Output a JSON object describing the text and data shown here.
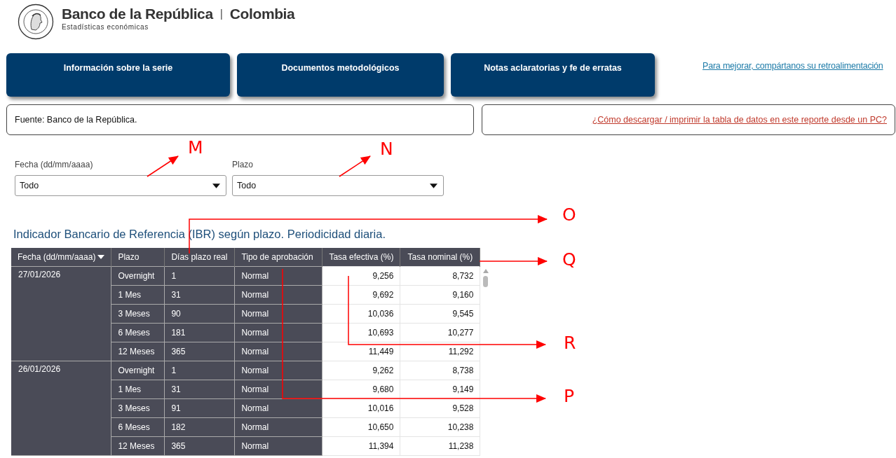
{
  "header": {
    "title": "Banco de la República",
    "separator": "|",
    "country": "Colombia",
    "subtitle": "Estadísticas económicas"
  },
  "nav_buttons": [
    "Información sobre la serie",
    "Documentos metodológicos",
    "Notas aclaratorias y fe de erratas"
  ],
  "feedback_link": "Para mejorar, compártanos su retroalimentación",
  "source": "Fuente: Banco de la República.",
  "help_link": "¿Cómo descargar / imprimir la tabla de datos en este reporte desde un PC?",
  "filters": [
    {
      "label": "Fecha (dd/mm/aaaa)",
      "value": "Todo"
    },
    {
      "label": "Plazo",
      "value": "Todo"
    }
  ],
  "table": {
    "title": "Indicador Bancario de Referencia (IBR) según plazo. Periodicidad diaria.",
    "columns": [
      {
        "label": "Fecha (dd/mm/aaaa)",
        "sorted": true
      },
      {
        "label": "Plazo",
        "sorted": false
      },
      {
        "label": "Días plazo real",
        "sorted": false
      },
      {
        "label": "Tipo de aprobación",
        "sorted": false
      },
      {
        "label": "Tasa efectiva (%)",
        "sorted": false
      },
      {
        "label": "Tasa nominal (%)",
        "sorted": false
      }
    ],
    "groups": [
      {
        "date": "27/01/2026",
        "rows": [
          [
            "Overnight",
            "1",
            "Normal",
            "9,256",
            "8,732"
          ],
          [
            "1 Mes",
            "31",
            "Normal",
            "9,692",
            "9,160"
          ],
          [
            "3 Meses",
            "90",
            "Normal",
            "10,036",
            "9,545"
          ],
          [
            "6 Meses",
            "181",
            "Normal",
            "10,693",
            "10,277"
          ],
          [
            "12 Meses",
            "365",
            "Normal",
            "11,449",
            "11,292"
          ]
        ]
      },
      {
        "date": "26/01/2026",
        "rows": [
          [
            "Overnight",
            "1",
            "Normal",
            "9,262",
            "8,738"
          ],
          [
            "1 Mes",
            "31",
            "Normal",
            "9,680",
            "9,149"
          ],
          [
            "3 Meses",
            "91",
            "Normal",
            "10,016",
            "9,528"
          ],
          [
            "6 Meses",
            "182",
            "Normal",
            "10,650",
            "10,238"
          ],
          [
            "12 Meses",
            "365",
            "Normal",
            "11,394",
            "11,238"
          ]
        ]
      }
    ]
  },
  "annotations": [
    {
      "label": "M",
      "kind": "diagonal"
    },
    {
      "label": "N",
      "kind": "diagonal"
    },
    {
      "label": "O",
      "kind": "elbow"
    },
    {
      "label": "Q",
      "kind": "straight"
    },
    {
      "label": "R",
      "kind": "elbow"
    },
    {
      "label": "P",
      "kind": "elbow"
    }
  ]
}
